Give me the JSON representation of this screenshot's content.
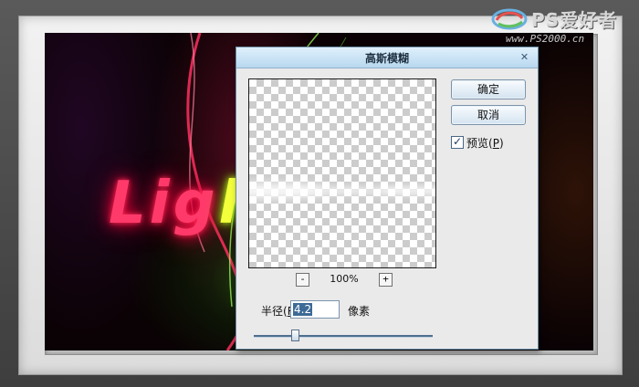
{
  "dialog": {
    "title": "高斯模糊",
    "ok_label": "确定",
    "cancel_label": "取消",
    "preview": {
      "label_prefix": "预览(",
      "label_key": "P",
      "label_suffix": ")",
      "checked": true
    },
    "zoom": {
      "minus": "-",
      "level": "100%",
      "plus": "+"
    },
    "radius": {
      "label_prefix": "半径(",
      "label_key": "R",
      "label_suffix": "):",
      "value": "4.2",
      "unit": "像素",
      "slider_fraction": 0.22
    }
  },
  "watermark": {
    "title": "PS爱好者",
    "url": "www.PS2000.cn"
  },
  "artwork": {
    "text_red": "Lig",
    "text_yellow": "h"
  },
  "icons": {
    "close": "close-icon",
    "checkmark": "checkmark-icon",
    "logo": "logo-icon"
  },
  "colors": {
    "titlebar": "#b8d8ef",
    "glow_red": "#ff2a55",
    "glow_green": "#60c000"
  }
}
